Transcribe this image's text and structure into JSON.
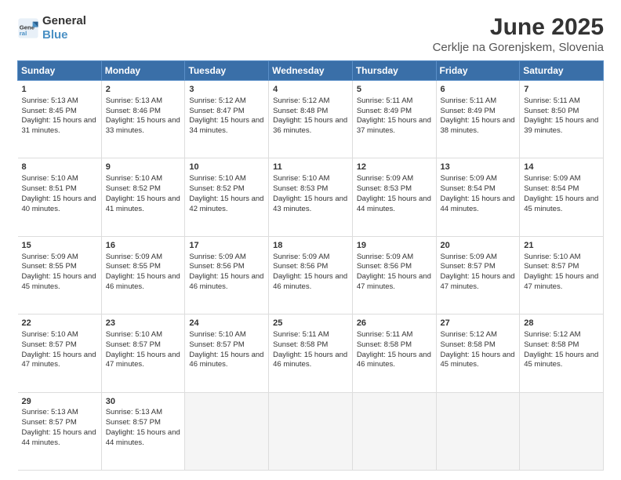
{
  "header": {
    "logo_general": "General",
    "logo_blue": "Blue",
    "title": "June 2025",
    "subtitle": "Cerklje na Gorenjskem, Slovenia"
  },
  "calendar": {
    "days": [
      "Sunday",
      "Monday",
      "Tuesday",
      "Wednesday",
      "Thursday",
      "Friday",
      "Saturday"
    ],
    "weeks": [
      [
        {
          "num": "1",
          "sunrise": "5:13 AM",
          "sunset": "8:45 PM",
          "daylight": "15 hours and 31 minutes."
        },
        {
          "num": "2",
          "sunrise": "5:13 AM",
          "sunset": "8:46 PM",
          "daylight": "15 hours and 33 minutes."
        },
        {
          "num": "3",
          "sunrise": "5:12 AM",
          "sunset": "8:47 PM",
          "daylight": "15 hours and 34 minutes."
        },
        {
          "num": "4",
          "sunrise": "5:12 AM",
          "sunset": "8:48 PM",
          "daylight": "15 hours and 36 minutes."
        },
        {
          "num": "5",
          "sunrise": "5:11 AM",
          "sunset": "8:49 PM",
          "daylight": "15 hours and 37 minutes."
        },
        {
          "num": "6",
          "sunrise": "5:11 AM",
          "sunset": "8:49 PM",
          "daylight": "15 hours and 38 minutes."
        },
        {
          "num": "7",
          "sunrise": "5:11 AM",
          "sunset": "8:50 PM",
          "daylight": "15 hours and 39 minutes."
        }
      ],
      [
        {
          "num": "8",
          "sunrise": "5:10 AM",
          "sunset": "8:51 PM",
          "daylight": "15 hours and 40 minutes."
        },
        {
          "num": "9",
          "sunrise": "5:10 AM",
          "sunset": "8:52 PM",
          "daylight": "15 hours and 41 minutes."
        },
        {
          "num": "10",
          "sunrise": "5:10 AM",
          "sunset": "8:52 PM",
          "daylight": "15 hours and 42 minutes."
        },
        {
          "num": "11",
          "sunrise": "5:10 AM",
          "sunset": "8:53 PM",
          "daylight": "15 hours and 43 minutes."
        },
        {
          "num": "12",
          "sunrise": "5:09 AM",
          "sunset": "8:53 PM",
          "daylight": "15 hours and 44 minutes."
        },
        {
          "num": "13",
          "sunrise": "5:09 AM",
          "sunset": "8:54 PM",
          "daylight": "15 hours and 44 minutes."
        },
        {
          "num": "14",
          "sunrise": "5:09 AM",
          "sunset": "8:54 PM",
          "daylight": "15 hours and 45 minutes."
        }
      ],
      [
        {
          "num": "15",
          "sunrise": "5:09 AM",
          "sunset": "8:55 PM",
          "daylight": "15 hours and 45 minutes."
        },
        {
          "num": "16",
          "sunrise": "5:09 AM",
          "sunset": "8:55 PM",
          "daylight": "15 hours and 46 minutes."
        },
        {
          "num": "17",
          "sunrise": "5:09 AM",
          "sunset": "8:56 PM",
          "daylight": "15 hours and 46 minutes."
        },
        {
          "num": "18",
          "sunrise": "5:09 AM",
          "sunset": "8:56 PM",
          "daylight": "15 hours and 46 minutes."
        },
        {
          "num": "19",
          "sunrise": "5:09 AM",
          "sunset": "8:56 PM",
          "daylight": "15 hours and 47 minutes."
        },
        {
          "num": "20",
          "sunrise": "5:09 AM",
          "sunset": "8:57 PM",
          "daylight": "15 hours and 47 minutes."
        },
        {
          "num": "21",
          "sunrise": "5:10 AM",
          "sunset": "8:57 PM",
          "daylight": "15 hours and 47 minutes."
        }
      ],
      [
        {
          "num": "22",
          "sunrise": "5:10 AM",
          "sunset": "8:57 PM",
          "daylight": "15 hours and 47 minutes."
        },
        {
          "num": "23",
          "sunrise": "5:10 AM",
          "sunset": "8:57 PM",
          "daylight": "15 hours and 47 minutes."
        },
        {
          "num": "24",
          "sunrise": "5:10 AM",
          "sunset": "8:57 PM",
          "daylight": "15 hours and 46 minutes."
        },
        {
          "num": "25",
          "sunrise": "5:11 AM",
          "sunset": "8:58 PM",
          "daylight": "15 hours and 46 minutes."
        },
        {
          "num": "26",
          "sunrise": "5:11 AM",
          "sunset": "8:58 PM",
          "daylight": "15 hours and 46 minutes."
        },
        {
          "num": "27",
          "sunrise": "5:12 AM",
          "sunset": "8:58 PM",
          "daylight": "15 hours and 45 minutes."
        },
        {
          "num": "28",
          "sunrise": "5:12 AM",
          "sunset": "8:58 PM",
          "daylight": "15 hours and 45 minutes."
        }
      ],
      [
        {
          "num": "29",
          "sunrise": "5:13 AM",
          "sunset": "8:57 PM",
          "daylight": "15 hours and 44 minutes."
        },
        {
          "num": "30",
          "sunrise": "5:13 AM",
          "sunset": "8:57 PM",
          "daylight": "15 hours and 44 minutes."
        },
        null,
        null,
        null,
        null,
        null
      ]
    ]
  }
}
